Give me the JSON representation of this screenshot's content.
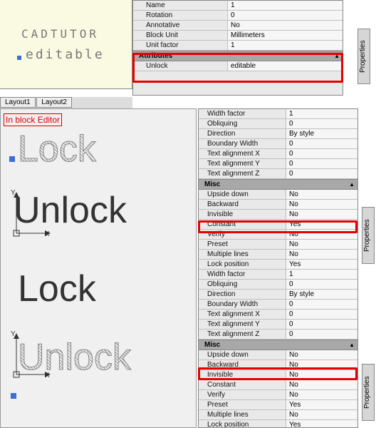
{
  "top": {
    "canvas_text1": "CADTUTOR",
    "canvas_text2": "editable",
    "tabs": [
      "Layout1",
      "Layout2"
    ],
    "props": [
      {
        "label": "Name",
        "value": "1"
      },
      {
        "label": "Rotation",
        "value": "0"
      },
      {
        "label": "Annotative",
        "value": "No"
      },
      {
        "label": "Block Unit",
        "value": "Millimeters"
      },
      {
        "label": "Unit factor",
        "value": "1"
      }
    ],
    "attr_section": "Attributes",
    "attr_rows": [
      {
        "label": "Unlock",
        "value": "editable"
      }
    ],
    "side_label": "Properties"
  },
  "bottom": {
    "editor_label": "In block Editor",
    "words": {
      "lock": "Lock",
      "unlock": "Unlock"
    },
    "ucs": {
      "x": "X",
      "y": "Y"
    },
    "panel_a": {
      "rows1": [
        {
          "label": "Width factor",
          "value": "1"
        },
        {
          "label": "Obliquing",
          "value": "0"
        },
        {
          "label": "Direction",
          "value": "By style"
        },
        {
          "label": "Boundary Width",
          "value": "0"
        },
        {
          "label": "Text alignment X",
          "value": "0"
        },
        {
          "label": "Text alignment Y",
          "value": "0"
        },
        {
          "label": "Text alignment Z",
          "value": "0"
        }
      ],
      "misc_hd": "Misc",
      "rows2": [
        {
          "label": "Upside down",
          "value": "No"
        },
        {
          "label": "Backward",
          "value": "No"
        },
        {
          "label": "Invisible",
          "value": "No"
        },
        {
          "label": "Constant",
          "value": "Yes"
        },
        {
          "label": "Verify",
          "value": "No"
        },
        {
          "label": "Preset",
          "value": "No"
        },
        {
          "label": "Multiple lines",
          "value": "No"
        },
        {
          "label": "Lock position",
          "value": "Yes"
        }
      ]
    },
    "panel_b": {
      "rows1": [
        {
          "label": "Width factor",
          "value": "1"
        },
        {
          "label": "Obliquing",
          "value": "0"
        },
        {
          "label": "Direction",
          "value": "By style"
        },
        {
          "label": "Boundary Width",
          "value": "0"
        },
        {
          "label": "Text alignment X",
          "value": "0"
        },
        {
          "label": "Text alignment Y",
          "value": "0"
        },
        {
          "label": "Text alignment Z",
          "value": "0"
        }
      ],
      "misc_hd": "Misc",
      "rows2": [
        {
          "label": "Upside down",
          "value": "No"
        },
        {
          "label": "Backward",
          "value": "No"
        },
        {
          "label": "Invisible",
          "value": "No"
        },
        {
          "label": "Constant",
          "value": "No"
        },
        {
          "label": "Verify",
          "value": "No"
        },
        {
          "label": "Preset",
          "value": "Yes"
        },
        {
          "label": "Multiple lines",
          "value": "No"
        },
        {
          "label": "Lock position",
          "value": "Yes"
        }
      ]
    },
    "side_label": "Properties"
  }
}
